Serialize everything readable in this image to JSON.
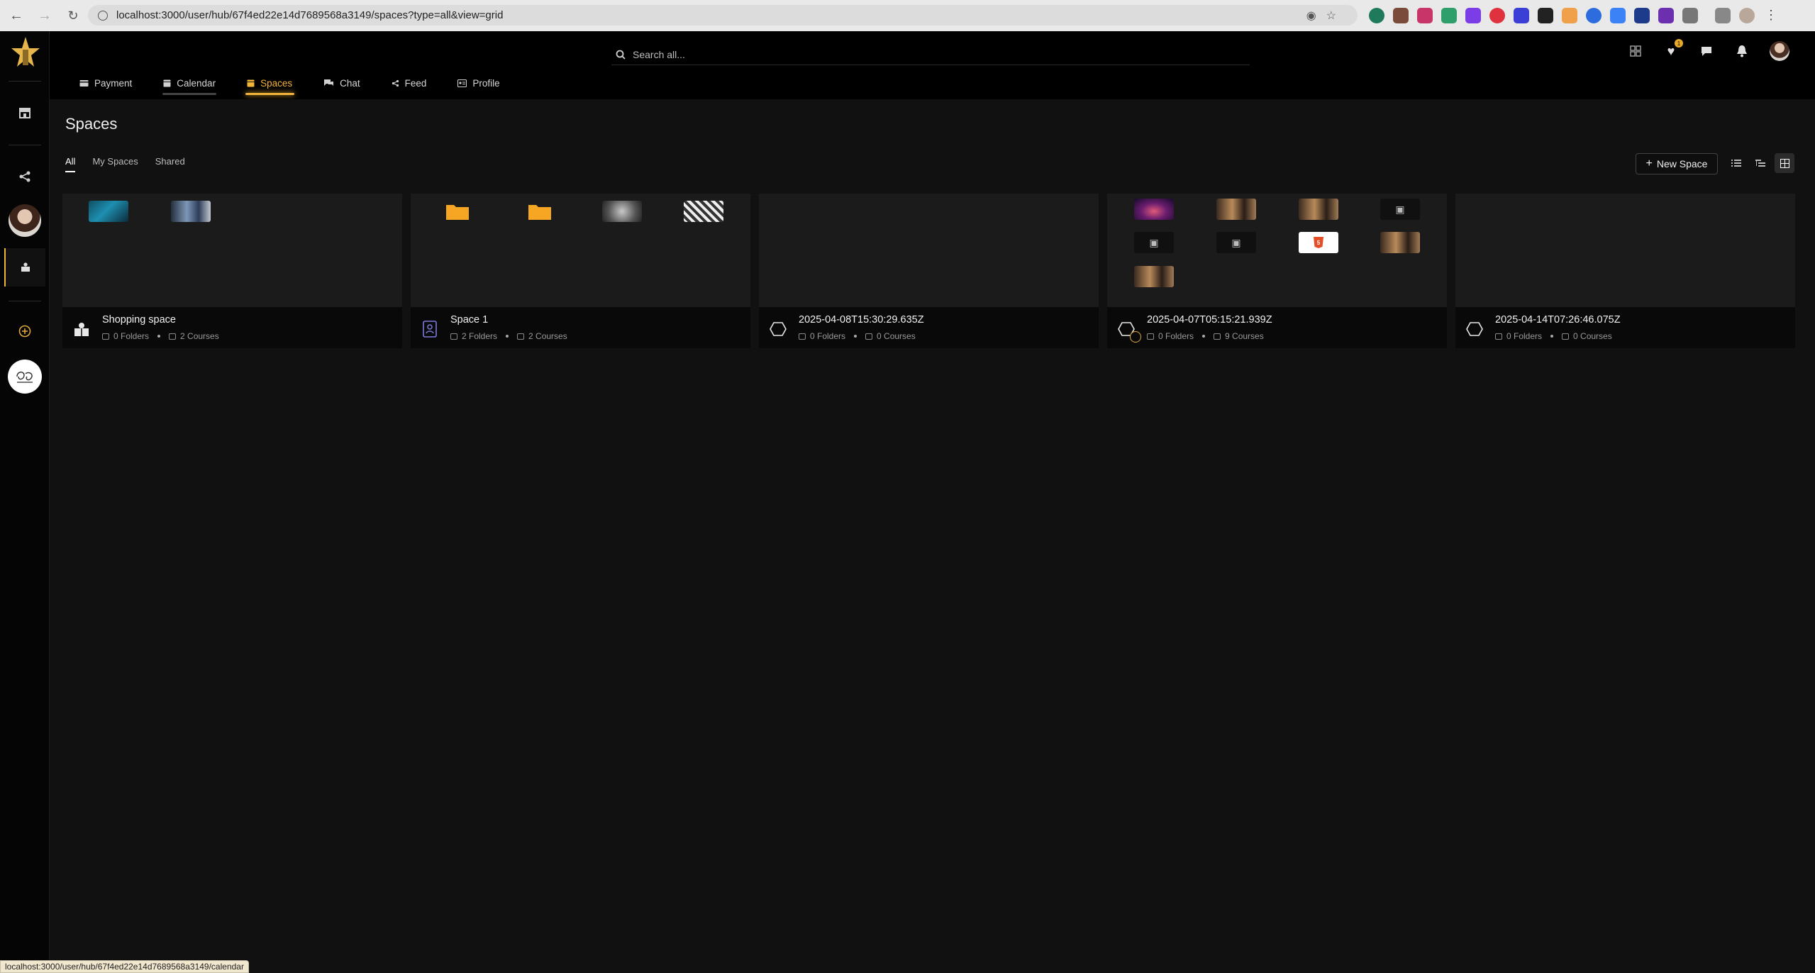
{
  "browser": {
    "url": "localhost:3000/user/hub/67f4ed22e14d7689568a3149/spaces?type=all&view=grid",
    "status_url": "localhost:3000/user/hub/67f4ed22e14d7689568a3149/calendar"
  },
  "search": {
    "placeholder": "Search all..."
  },
  "notifications": {
    "wishlist_count": "1"
  },
  "tabs": [
    {
      "label": "Payment",
      "icon": "wallet-icon"
    },
    {
      "label": "Calendar",
      "icon": "calendar-icon"
    },
    {
      "label": "Spaces",
      "icon": "spaces-icon",
      "active": true
    },
    {
      "label": "Chat",
      "icon": "chat-icon"
    },
    {
      "label": "Feed",
      "icon": "share-icon"
    },
    {
      "label": "Profile",
      "icon": "id-card-icon"
    }
  ],
  "page": {
    "title": "Spaces"
  },
  "filters": [
    {
      "label": "All",
      "active": true
    },
    {
      "label": "My Spaces"
    },
    {
      "label": "Shared"
    }
  ],
  "actions": {
    "new_space": "New Space"
  },
  "colors": {
    "accent": "#f3b43a",
    "background": "#111111",
    "sidebar": "#050505"
  },
  "cards": [
    {
      "title": "Shopping space",
      "folders": "0 Folders",
      "courses": "2 Courses"
    },
    {
      "title": "Space 1",
      "folders": "2 Folders",
      "courses": "2 Courses"
    },
    {
      "title": "2025-04-08T15:30:29.635Z",
      "folders": "0 Folders",
      "courses": "0 Courses"
    },
    {
      "title": "2025-04-07T05:15:21.939Z",
      "folders": "0 Folders",
      "courses": "9 Courses"
    },
    {
      "title": "2025-04-14T07:26:46.075Z",
      "folders": "0 Folders",
      "courses": "0 Courses"
    }
  ]
}
